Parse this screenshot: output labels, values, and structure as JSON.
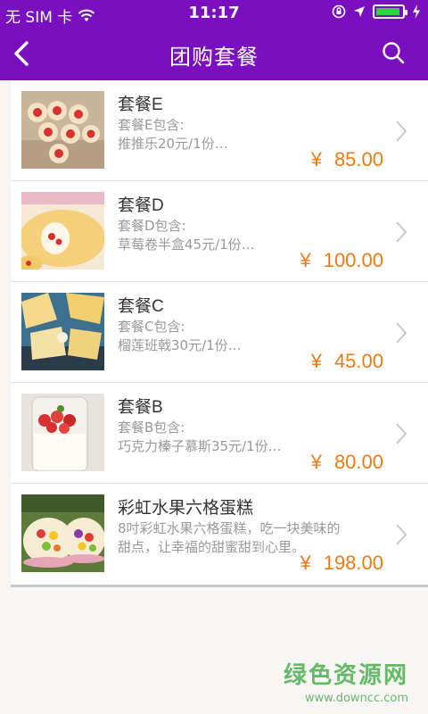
{
  "status_bar": {
    "carrier": "无 SIM 卡",
    "time": "11:17",
    "icons": [
      "wifi-icon",
      "rotation-lock-icon",
      "location-arrow-icon",
      "battery-icon",
      "charging-bolt-icon"
    ]
  },
  "nav": {
    "title": "团购套餐",
    "back_icon": "chevron-left-icon",
    "search_icon": "search-icon"
  },
  "colors": {
    "header": "#7a0fc0",
    "price": "#f07a10",
    "watermark": "#4caf50"
  },
  "items": [
    {
      "title": "套餐E",
      "desc_line1": "套餐E包含:",
      "desc_line2": "推推乐20元/1份…",
      "currency": "¥",
      "price": "85.00"
    },
    {
      "title": "套餐D",
      "desc_line1": "套餐D包含:",
      "desc_line2": "草莓卷半盒45元/1份…",
      "currency": "¥",
      "price": "100.00"
    },
    {
      "title": "套餐C",
      "desc_line1": "套餐C包含:",
      "desc_line2": "榴莲班戟30元/1份…",
      "currency": "¥",
      "price": "45.00"
    },
    {
      "title": "套餐B",
      "desc_line1": "套餐B包含:",
      "desc_line2": "巧克力榛子慕斯35元/1份…",
      "currency": "¥",
      "price": "80.00"
    },
    {
      "title": "彩虹水果六格蛋糕",
      "desc_line1": "8吋彩虹水果六格蛋糕，吃一块美味的",
      "desc_line2": "甜点，让幸福的甜蜜甜到心里。",
      "currency": "¥",
      "price": "198.00"
    }
  ],
  "watermark": {
    "main": "绿色资源网",
    "sub": "www.downcc.com"
  }
}
